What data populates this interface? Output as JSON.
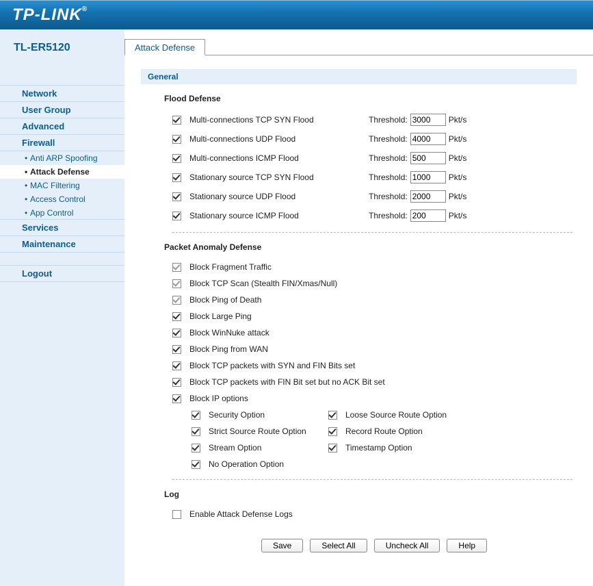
{
  "brand": "TP-LINK",
  "model": "TL-ER5120",
  "tab": "Attack Defense",
  "sectionHeader": "General",
  "nav": {
    "network": "Network",
    "usergroup": "User Group",
    "advanced": "Advanced",
    "firewall": "Firewall",
    "services": "Services",
    "maintenance": "Maintenance",
    "logout": "Logout",
    "sub": {
      "arp": "Anti ARP Spoofing",
      "attack": "Attack Defense",
      "mac": "MAC Filtering",
      "access": "Access Control",
      "app": "App Control"
    }
  },
  "flood": {
    "title": "Flood Defense",
    "thresholdLabel": "Threshold:",
    "unit": "Pkt/s",
    "rows": [
      {
        "label": "Multi-connections TCP SYN Flood",
        "value": "3000",
        "checked": true
      },
      {
        "label": "Multi-connections UDP Flood",
        "value": "4000",
        "checked": true
      },
      {
        "label": "Multi-connections ICMP Flood",
        "value": "500",
        "checked": true
      },
      {
        "label": "Stationary source TCP SYN Flood",
        "value": "1000",
        "checked": true
      },
      {
        "label": "Stationary source UDP Flood",
        "value": "2000",
        "checked": true
      },
      {
        "label": "Stationary source ICMP Flood",
        "value": "200",
        "checked": true
      }
    ]
  },
  "anomaly": {
    "title": "Packet Anomaly Defense",
    "rows": [
      {
        "label": "Block Fragment Traffic",
        "checked": true,
        "gray": true
      },
      {
        "label": "Block TCP Scan (Stealth FIN/Xmas/Null)",
        "checked": true,
        "gray": true
      },
      {
        "label": "Block Ping of Death",
        "checked": true,
        "gray": true
      },
      {
        "label": "Block Large Ping",
        "checked": true
      },
      {
        "label": "Block WinNuke attack",
        "checked": true
      },
      {
        "label": "Block Ping from WAN",
        "checked": true
      },
      {
        "label": "Block TCP packets with SYN and FIN Bits set",
        "checked": true
      },
      {
        "label": "Block TCP packets with FIN Bit set but no ACK Bit set",
        "checked": true
      },
      {
        "label": "Block IP options",
        "checked": true
      }
    ],
    "ipopts": [
      "Security Option",
      "Loose Source Route Option",
      "Strict Source Route Option",
      "Record Route Option",
      "Stream Option",
      "Timestamp Option",
      "No Operation Option"
    ]
  },
  "log": {
    "title": "Log",
    "enable": "Enable Attack Defense Logs",
    "checked": false
  },
  "buttons": {
    "save": "Save",
    "selectAll": "Select All",
    "uncheckAll": "Uncheck All",
    "help": "Help"
  }
}
